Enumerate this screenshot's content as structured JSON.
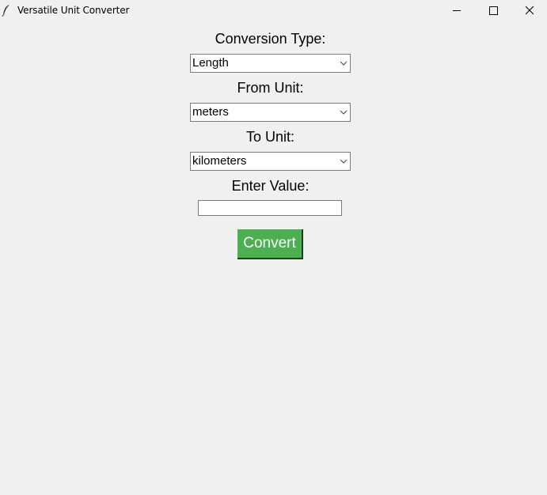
{
  "window": {
    "title": "Versatile Unit Converter",
    "app_icon": "feather-icon",
    "controls": [
      "minimize-icon",
      "maximize-icon",
      "close-icon"
    ]
  },
  "form": {
    "conversion_type_label": "Conversion Type:",
    "conversion_type_value": "Length",
    "from_unit_label": "From Unit:",
    "from_unit_value": "meters",
    "to_unit_label": "To Unit:",
    "to_unit_value": "kilometers",
    "value_label": "Enter Value:",
    "value_input": "",
    "convert_label": "Convert"
  },
  "colors": {
    "background": "#f0f0f0",
    "convert_button": "#4caf50",
    "convert_text": "#ffffff"
  }
}
